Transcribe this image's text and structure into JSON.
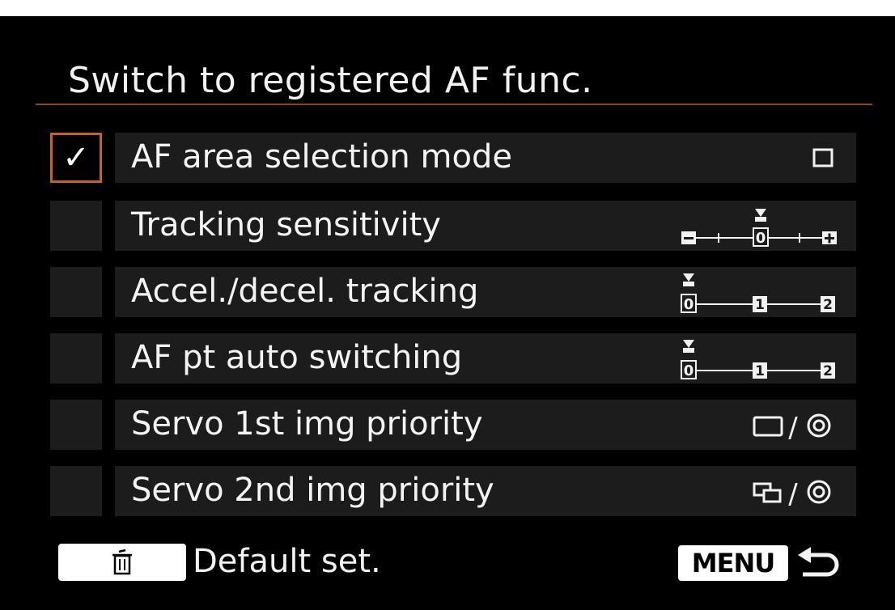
{
  "title": "Switch to registered AF func.",
  "colors": {
    "accent": "#c4622a",
    "rule": "#8a4a22",
    "row_bg": "#1c1c1c",
    "bg": "#000000",
    "text": "#f2f2f2"
  },
  "items": [
    {
      "label": "AF area selection mode",
      "checked": true,
      "value_icon": "single-point-af-icon"
    },
    {
      "label": "Tracking sensitivity",
      "checked": false,
      "value_icon": "tracking-sensitivity-scale-icon",
      "scale": [
        "-",
        "0",
        "+"
      ],
      "selected": "0"
    },
    {
      "label": "Accel./decel. tracking",
      "checked": false,
      "value_icon": "three-step-scale-icon",
      "scale": [
        "0",
        "1",
        "2"
      ],
      "selected": "0"
    },
    {
      "label": "AF pt auto switching",
      "checked": false,
      "value_icon": "three-step-scale-icon",
      "scale": [
        "0",
        "1",
        "2"
      ],
      "selected": "0"
    },
    {
      "label": "Servo 1st img priority",
      "checked": false,
      "value_icon": "release-focus-priority-icon",
      "value_sep": "/"
    },
    {
      "label": "Servo 2nd img priority",
      "checked": false,
      "value_icon": "drive-focus-priority-icon",
      "value_sep": "/"
    }
  ],
  "footer": {
    "trash_icon": "trash-icon",
    "default_label": "Default set.",
    "menu_label": "MENU",
    "back_icon": "return-arrow-icon"
  }
}
